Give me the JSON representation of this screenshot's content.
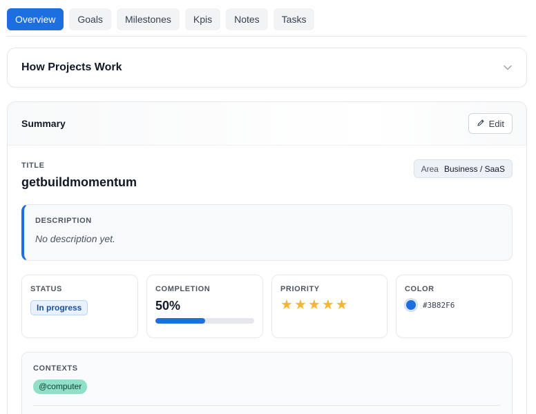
{
  "tabs": [
    {
      "label": "Overview",
      "active": true
    },
    {
      "label": "Goals",
      "active": false
    },
    {
      "label": "Milestones",
      "active": false
    },
    {
      "label": "Kpis",
      "active": false
    },
    {
      "label": "Notes",
      "active": false
    },
    {
      "label": "Tasks",
      "active": false
    }
  ],
  "accordion": {
    "title": "How Projects Work",
    "icon": "chevron-down-icon"
  },
  "summary": {
    "title": "Summary",
    "edit_label": "Edit",
    "edit_icon": "pencil-icon",
    "title_label": "TITLE",
    "title_value": "getbuildmomentum",
    "area_key": "Area",
    "area_value": "Business / SaaS",
    "description_label": "DESCRIPTION",
    "description_text": "No description yet.",
    "status_label": "STATUS",
    "status_value": "In progress",
    "completion_label": "COMPLETION",
    "completion_value": "50%",
    "completion_fraction": 0.5,
    "priority_label": "PRIORITY",
    "priority_stars": 5,
    "color_label": "COLOR",
    "color_value": "#3B82F6",
    "contexts_label": "CONTEXTS",
    "contexts": [
      "@computer"
    ]
  },
  "colors": {
    "accent": "#1d6fe0",
    "star": "#f5b731",
    "swatch": "#1d6fe0",
    "context_badge": "#8fe0c7"
  }
}
